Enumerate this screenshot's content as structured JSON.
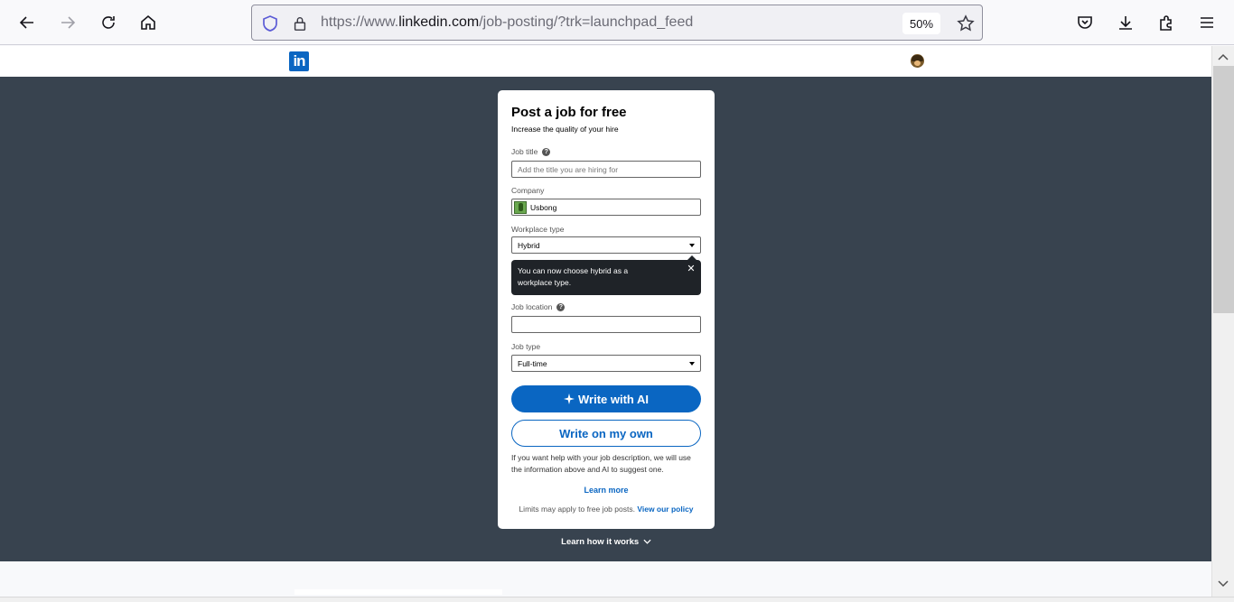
{
  "browser": {
    "url_prefix": "https://www.",
    "url_domain": "linkedin.com",
    "url_path": "/job-posting/?trk=launchpad_feed",
    "zoom": "50%"
  },
  "header": {
    "logo_text": "in"
  },
  "form": {
    "title": "Post a job for free",
    "subtitle": "Increase the quality of your hire",
    "job_title_label": "Job title",
    "job_title_placeholder": "Add the title you are hiring for",
    "company_label": "Company",
    "company_value": "Usbong",
    "workplace_label": "Workplace type",
    "workplace_value": "Hybrid",
    "tooltip_text": "You can now choose hybrid as a workplace type.",
    "location_label": "Job location",
    "location_value": "",
    "job_type_label": "Job type",
    "job_type_value": "Full-time",
    "ai_button": "Write with AI",
    "own_button": "Write on my own",
    "help_text": "If you want help with your job description, we will use the information above and AI to suggest one.",
    "learn_more": "Learn more",
    "policy_text": "Limits may apply to free job posts.",
    "policy_link": "View our policy"
  },
  "learn_how": "Learn how it works",
  "colors": {
    "linkedin_blue": "#0a66c2",
    "page_bg": "#38434f",
    "tooltip_bg": "#1f2328"
  }
}
